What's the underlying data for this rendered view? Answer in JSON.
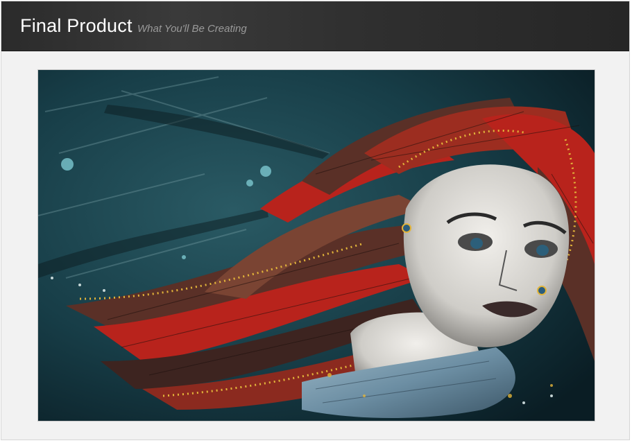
{
  "header": {
    "title": "Final Product",
    "subtitle": "What You'll Be Creating"
  },
  "artwork": {
    "icon": "illustration-image",
    "colors": {
      "background": "#173d47",
      "hair_red": "#b8231c",
      "hair_brown": "#5a3027",
      "skin": "#e6e4e0",
      "scarf": "#7f9fb3",
      "accent_yellow": "#e2b43a"
    }
  }
}
